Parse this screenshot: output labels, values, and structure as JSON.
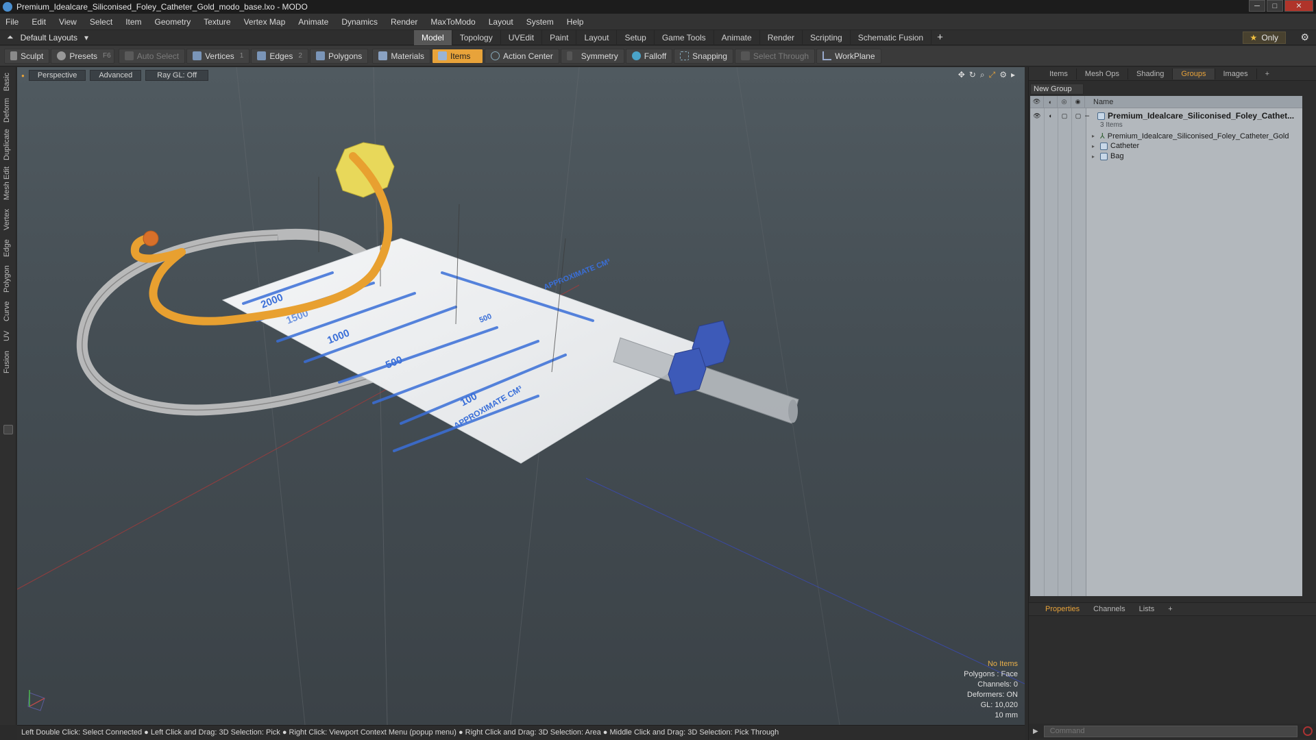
{
  "window": {
    "title": "Premium_Idealcare_Siliconised_Foley_Catheter_Gold_modo_base.lxo - MODO",
    "buttons": {
      "minimize": "─",
      "maximize": "□",
      "close": "✕"
    }
  },
  "menu": [
    "File",
    "Edit",
    "View",
    "Select",
    "Item",
    "Geometry",
    "Texture",
    "Vertex Map",
    "Animate",
    "Dynamics",
    "Render",
    "MaxToModo",
    "Layout",
    "System",
    "Help"
  ],
  "layout": {
    "selector": "Default Layouts",
    "tabs": [
      "Model",
      "Topology",
      "UVEdit",
      "Paint",
      "Layout",
      "Setup",
      "Game Tools",
      "Animate",
      "Render",
      "Scripting",
      "Schematic Fusion"
    ],
    "active_tab": "Model",
    "only_label": "Only"
  },
  "toolbar": {
    "sculpt": "Sculpt",
    "presets": "Presets",
    "presets_key": "F6",
    "auto_select": "Auto Select",
    "vertices": "Vertices",
    "vertices_key": "1",
    "edges": "Edges",
    "edges_key": "2",
    "polygons": "Polygons",
    "materials": "Materials",
    "items": "Items",
    "action_center": "Action Center",
    "symmetry": "Symmetry",
    "falloff": "Falloff",
    "snapping": "Snapping",
    "select_through": "Select Through",
    "workplane": "WorkPlane"
  },
  "left_tabs": [
    "Basic",
    "Deform",
    "Duplicate",
    "Mesh Edit",
    "Vertex",
    "Edge",
    "Polygon",
    "Curve",
    "UV",
    "Fusion"
  ],
  "viewport": {
    "view": "Perspective",
    "shading": "Advanced",
    "raygl": "Ray GL: Off",
    "info": {
      "selection": "No Items",
      "polygons": "Polygons : Face",
      "channels": "Channels: 0",
      "deformers": "Deformers: ON",
      "gl": "GL: 10,020",
      "unit": "10 mm"
    },
    "bag_labels": [
      "2000",
      "1500",
      "1000",
      "500",
      "100",
      "500",
      "APPROXIMATE CM³",
      "APPROXIMATE CM³"
    ]
  },
  "status_bar": "Left Double Click: Select Connected ● Left Click and Drag: 3D Selection: Pick ● Right Click: Viewport Context Menu (popup menu) ● Right Click and Drag: 3D Selection: Area ● Middle Click and Drag: 3D Selection: Pick Through",
  "right_panel": {
    "tabs": [
      "Items",
      "Mesh Ops",
      "Shading",
      "Groups",
      "Images"
    ],
    "active_tab": "Groups",
    "new_group": "New Group",
    "column_name": "Name",
    "tree": {
      "root": "Premium_Idealcare_Siliconised_Foley_Cathet...",
      "root_count": "3 Items",
      "children": [
        "Premium_Idealcare_Siliconised_Foley_Catheter_Gold",
        "Catheter",
        "Bag"
      ]
    },
    "bottom_tabs": [
      "Properties",
      "Channels",
      "Lists"
    ],
    "bottom_active": "Properties",
    "command_placeholder": "Command"
  },
  "colors": {
    "accent": "#e8a33a",
    "catheter": "#e8a030",
    "bag_marking": "#3a6fd8",
    "valve": "#3d5ab8"
  }
}
